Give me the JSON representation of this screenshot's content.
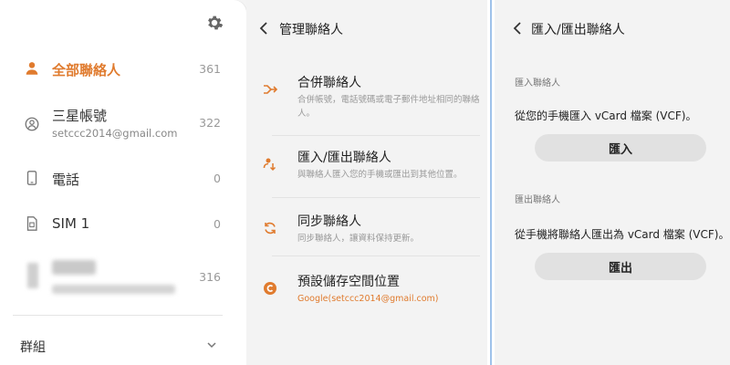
{
  "accounts": {
    "items": [
      {
        "label": "全部聯絡人",
        "count": "361",
        "icon": "person-icon"
      },
      {
        "label": "三星帳號",
        "sub": "setccc2014@gmail.com",
        "count": "322",
        "icon": "samsung-account-icon"
      },
      {
        "label": "電話",
        "count": "0",
        "icon": "phone-icon"
      },
      {
        "label": "SIM 1",
        "count": "0",
        "icon": "sim-card-icon"
      },
      {
        "label": "",
        "count": "316",
        "icon": "blurred-account-icon"
      }
    ],
    "group_label": "群組"
  },
  "manage": {
    "title": "管理聯絡人",
    "items": [
      {
        "title": "合併聯絡人",
        "desc": "合併帳號，電話號碼或電子郵件地址相同的聯絡人。"
      },
      {
        "title": "匯入/匯出聯絡人",
        "desc": "與聯絡人匯入您的手機或匯出到其他位置。"
      },
      {
        "title": "同步聯絡人",
        "desc": "同步聯絡人，讓資料保持更新。"
      },
      {
        "title": "預設儲存空間位置",
        "desc": "Google(setccc2014@gmail.com)"
      }
    ]
  },
  "import_export": {
    "title": "匯入/匯出聯絡人",
    "import_section": "匯入聯絡人",
    "import_desc": "從您的手機匯入 vCard 檔案 (VCF)。",
    "import_button": "匯入",
    "export_section": "匯出聯絡人",
    "export_desc": "從手機將聯絡人匯出為 vCard 檔案 (VCF)。",
    "export_button": "匯出"
  },
  "colors": {
    "accent": "#e07b2e",
    "divider": "#9fc2ea"
  }
}
